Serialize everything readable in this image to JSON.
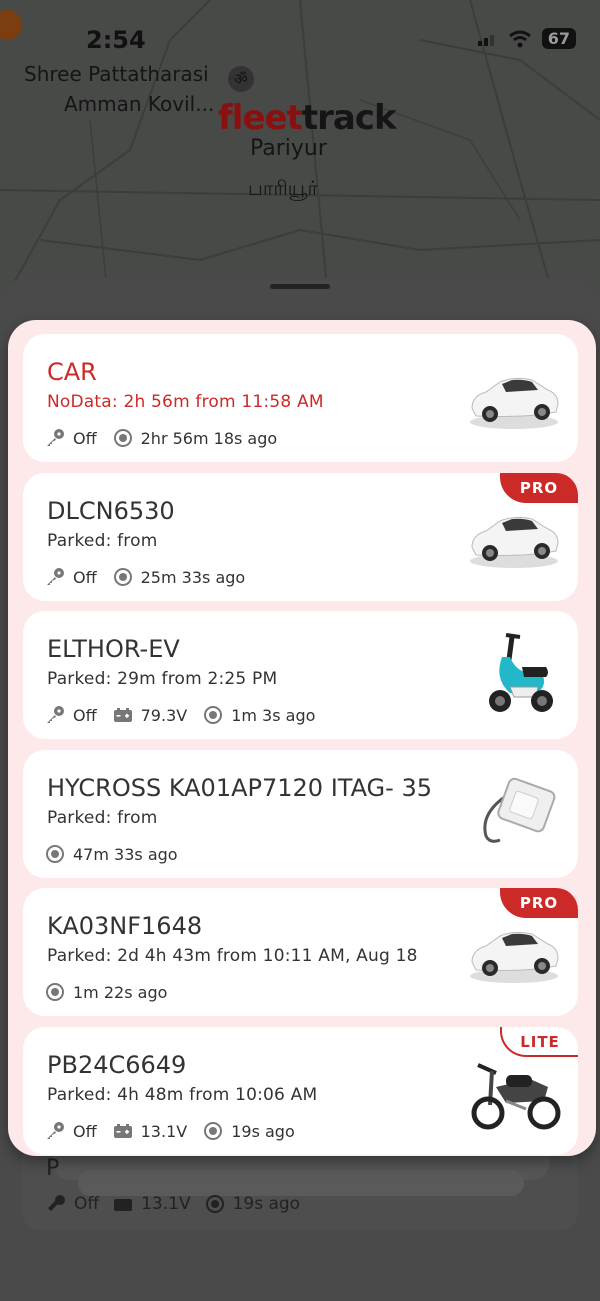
{
  "status_bar": {
    "time": "2:54",
    "battery": "67"
  },
  "map": {
    "labels": [
      "Shree Pattatharasi",
      "Amman Kovil...",
      "Pariyur",
      "பாரியூர்"
    ],
    "logo": {
      "part1": "fleet",
      "part2": "track"
    }
  },
  "vehicles": [
    {
      "name": "CAR",
      "status": "NoData: 2h 56m from 11:58 AM",
      "alert": true,
      "badge": "",
      "image": "car-image",
      "ignition": "Off",
      "voltage": "",
      "last_update": "2hr 56m 18s ago"
    },
    {
      "name": "DLCN6530",
      "status": "Parked:  from",
      "alert": false,
      "badge": "PRO",
      "image": "car-image",
      "ignition": "Off",
      "voltage": "",
      "last_update": "25m 33s ago"
    },
    {
      "name": "ELTHOR-EV",
      "status": "Parked: 29m from 2:25 PM",
      "alert": false,
      "badge": "",
      "image": "scooter-image",
      "ignition": "Off",
      "voltage": "79.3V",
      "last_update": "1m 3s ago"
    },
    {
      "name": "HYCROSS KA01AP7120 ITAG- 35",
      "status": "Parked:  from",
      "alert": false,
      "badge": "",
      "image": "tracker-device-image",
      "ignition": "",
      "voltage": "",
      "last_update": "47m 33s ago"
    },
    {
      "name": "KA03NF1648",
      "status": "Parked: 2d 4h 43m from 10:11 AM, Aug 18",
      "alert": false,
      "badge": "PRO",
      "image": "car-image",
      "ignition": "",
      "voltage": "",
      "last_update": "1m 22s ago"
    },
    {
      "name": "PB24C6649",
      "status": "Parked: 4h 48m from 10:06 AM",
      "alert": false,
      "badge": "LITE",
      "image": "motorcycle-image",
      "ignition": "Off",
      "voltage": "13.1V",
      "last_update": "19s ago"
    }
  ],
  "background_row": {
    "letter": "P",
    "ignition": "Off",
    "voltage": "13.1V",
    "last_update": "19s ago"
  },
  "colors": {
    "accent": "#cc2a28",
    "popup_bg": "#fde9e9",
    "card_bg": "#ffffff"
  }
}
